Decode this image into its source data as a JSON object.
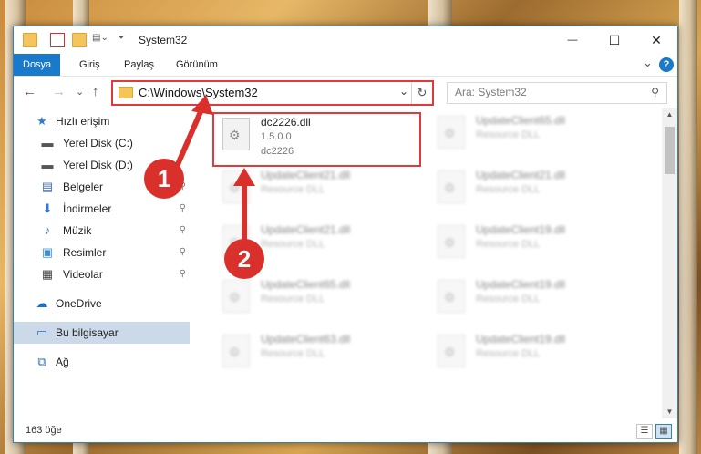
{
  "window": {
    "title": "System32",
    "controls": {
      "minimize": "—",
      "maximize": "☐",
      "close": "✕"
    }
  },
  "ribbon": {
    "tabs": [
      "Dosya",
      "Giriş",
      "Paylaş",
      "Görünüm"
    ],
    "expand": "⌄",
    "help": "?"
  },
  "nav": {
    "back": "←",
    "forward": "→",
    "recent": "⌄",
    "up": "↑",
    "address": "C:\\Windows\\System32",
    "address_dropdown": "⌄",
    "refresh": "↻",
    "search_placeholder": "Ara: System32",
    "search_icon": "⚲"
  },
  "sidebar": {
    "items": [
      {
        "label": "Hızlı erişim",
        "icon": "star-icon",
        "glyph": "★",
        "color": "#2f7bd1"
      },
      {
        "label": "Yerel Disk (C:)",
        "icon": "disk-icon",
        "glyph": "▬",
        "color": "#555"
      },
      {
        "label": "Yerel Disk (D:)",
        "icon": "disk-icon",
        "glyph": "▬",
        "color": "#555"
      },
      {
        "label": "Belgeler",
        "icon": "documents-icon",
        "glyph": "▤",
        "color": "#3a6fb0",
        "pin": "📌"
      },
      {
        "label": "İndirmeler",
        "icon": "downloads-icon",
        "glyph": "⬇",
        "color": "#2f7bd1",
        "pin": "📌"
      },
      {
        "label": "Müzik",
        "icon": "music-icon",
        "glyph": "♪",
        "color": "#2f7bd1",
        "pin": "📌"
      },
      {
        "label": "Resimler",
        "icon": "pictures-icon",
        "glyph": "▣",
        "color": "#3a8fd1",
        "pin": "📌"
      },
      {
        "label": "Videolar",
        "icon": "videos-icon",
        "glyph": "▦",
        "color": "#444",
        "pin": "📌"
      },
      {
        "label": "OneDrive",
        "icon": "cloud-icon",
        "glyph": "☁",
        "color": "#1a6fc7"
      },
      {
        "label": "Bu bilgisayar",
        "icon": "computer-icon",
        "glyph": "▭",
        "color": "#2c6fb7"
      },
      {
        "label": "Ağ",
        "icon": "network-icon",
        "glyph": "⧉",
        "color": "#2c6fb7"
      }
    ]
  },
  "files": [
    {
      "name": "dc2226.dll",
      "line2": "1.5.0.0",
      "line3": "dc2226"
    },
    {
      "name": "UpdateClient21.dll",
      "line2": "Resource DLL"
    },
    {
      "name": "UpdateClient21.dll",
      "line2": "Resource DLL"
    },
    {
      "name": "UpdateClient65.dll",
      "line2": "Resource DLL"
    },
    {
      "name": "UpdateClient63.dll",
      "line2": "Resource DLL"
    },
    {
      "name": "UpdateClient65.dll",
      "line2": "Resource DLL"
    },
    {
      "name": "UpdateClient21.dll",
      "line2": "Resource DLL"
    },
    {
      "name": "UpdateClient19.dll",
      "line2": "Resource DLL"
    },
    {
      "name": "UpdateClient19.dll",
      "line2": "Resource DLL"
    },
    {
      "name": "UpdateClient19.dll",
      "line2": "Resource DLL"
    }
  ],
  "status": {
    "count": "163 öğe",
    "view_details": "☰",
    "view_tiles": "▦"
  },
  "annotations": {
    "badge1": "1",
    "badge2": "2",
    "accent": "#d9302c"
  }
}
